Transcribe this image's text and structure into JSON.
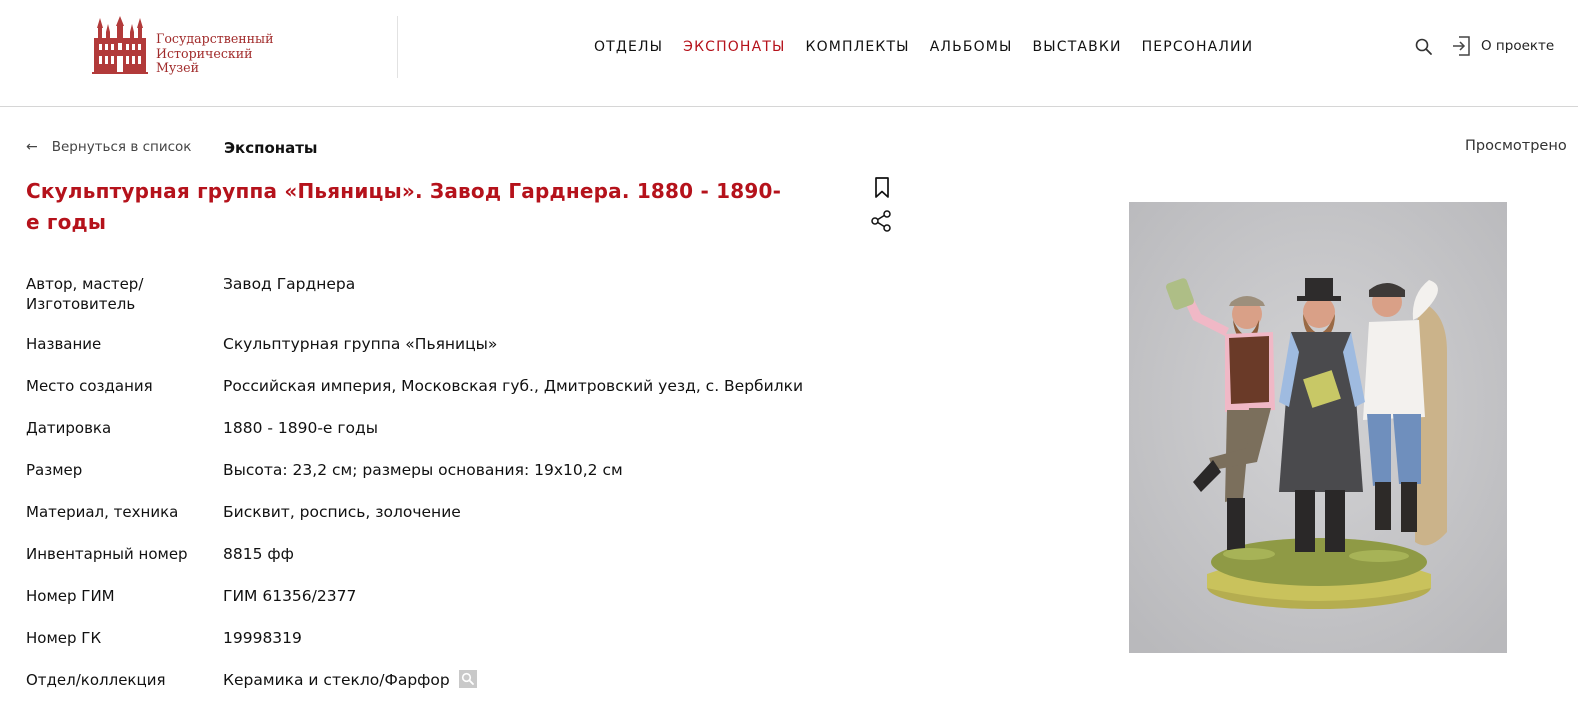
{
  "logo": {
    "lines": [
      "Государственный",
      "Исторический",
      "Музей"
    ]
  },
  "nav": {
    "items": [
      {
        "label": "ОТДЕЛЫ"
      },
      {
        "label": "ЭКСПОНАТЫ",
        "active": true
      },
      {
        "label": "КОМПЛЕКТЫ"
      },
      {
        "label": "АЛЬБОМЫ"
      },
      {
        "label": "ВЫСТАВКИ"
      },
      {
        "label": "ПЕРСОНАЛИИ"
      }
    ],
    "search_icon": "search-icon",
    "about_label": "О проекте",
    "about_icon": "login-icon"
  },
  "subbar": {
    "back_arrow": "←",
    "back_label": "Вернуться в список",
    "section": "Экспонаты",
    "viewed": "Просмотрено"
  },
  "exhibit": {
    "title": "Скульптурная группа «Пьяницы». Завод Гарднера. 1880 - 1890-е годы",
    "actions": [
      "bookmark-icon",
      "share-icon"
    ],
    "details": [
      {
        "label": "Автор, мастер/ Изготовитель",
        "value": "Завод Гарднера"
      },
      {
        "label": "Название",
        "value": "Скульптурная группа «Пьяницы»"
      },
      {
        "label": "Место создания",
        "value": "Российская империя, Московская губ., Дмитровский уезд, с. Вербилки"
      },
      {
        "label": "Датировка",
        "value": "1880 - 1890-е годы"
      },
      {
        "label": "Размер",
        "value": "Высота: 23,2 см; размеры основания: 19x10,2 см"
      },
      {
        "label": "Материал, техника",
        "value": "Бисквит, роспись, золочение"
      },
      {
        "label": "Инвентарный номер",
        "value": "8815 фф"
      },
      {
        "label": "Номер ГИМ",
        "value": "ГИМ 61356/2377"
      },
      {
        "label": "Номер ГК",
        "value": "19998319"
      },
      {
        "label": "Отдел/коллекция",
        "value": "Керамика и стекло/Фарфор"
      }
    ]
  },
  "colors": {
    "accent": "#b5121b",
    "logo": "#a12b2b",
    "photo_bg": "#c7c7c9"
  }
}
